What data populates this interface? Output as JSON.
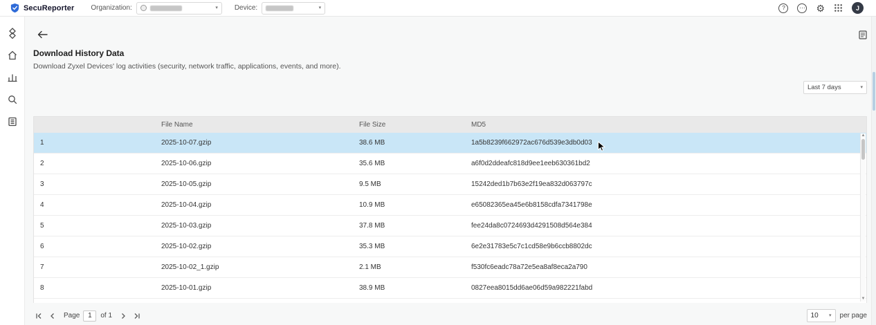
{
  "topbar": {
    "brand": "SecuReporter",
    "organization_label": "Organization:",
    "device_label": "Device:",
    "avatar_initial": "J",
    "icons": [
      "help-icon",
      "more-icon",
      "gear-icon",
      "apps-grid-icon"
    ]
  },
  "page": {
    "title": "Download History Data",
    "subtitle": "Download Zyxel Devices' log activities (security, network traffic, applications, events, and more).",
    "date_range": "Last 7 days"
  },
  "table": {
    "columns": {
      "index": "",
      "file_name": "File Name",
      "file_size": "File Size",
      "md5": "MD5"
    },
    "rows": [
      {
        "index": "1",
        "file_name": "2025-10-07.gzip",
        "file_size": "38.6 MB",
        "md5": "1a5b8239f662972ac676d539e3db0d03",
        "selected": true
      },
      {
        "index": "2",
        "file_name": "2025-10-06.gzip",
        "file_size": "35.6 MB",
        "md5": "a6f0d2ddeafc818d9ee1eeb630361bd2",
        "selected": false
      },
      {
        "index": "3",
        "file_name": "2025-10-05.gzip",
        "file_size": "9.5 MB",
        "md5": "15242ded1b7b63e2f19ea832d063797c",
        "selected": false
      },
      {
        "index": "4",
        "file_name": "2025-10-04.gzip",
        "file_size": "10.9 MB",
        "md5": "e65082365ea45e6b8158cdfa7341798e",
        "selected": false
      },
      {
        "index": "5",
        "file_name": "2025-10-03.gzip",
        "file_size": "37.8 MB",
        "md5": "fee24da8c0724693d4291508d564e384",
        "selected": false
      },
      {
        "index": "6",
        "file_name": "2025-10-02.gzip",
        "file_size": "35.3 MB",
        "md5": "6e2e31783e5c7c1cd58e9b6ccb8802dc",
        "selected": false
      },
      {
        "index": "7",
        "file_name": "2025-10-02_1.gzip",
        "file_size": "2.1 MB",
        "md5": "f530fc6eadc78a72e5ea8af8eca2a790",
        "selected": false
      },
      {
        "index": "8",
        "file_name": "2025-10-01.gzip",
        "file_size": "38.9 MB",
        "md5": "0827eea8015dd6ae06d59a982221fabd",
        "selected": false
      }
    ]
  },
  "pagination": {
    "page_label": "Page",
    "current_page": "1",
    "of_label": "of 1",
    "page_size": "10",
    "per_page_label": "per page"
  },
  "colors": {
    "brand_blue": "#2f6bd8",
    "selected_row": "#c9e6f7",
    "scroll_thumb_blue": "#b7cfe2"
  }
}
